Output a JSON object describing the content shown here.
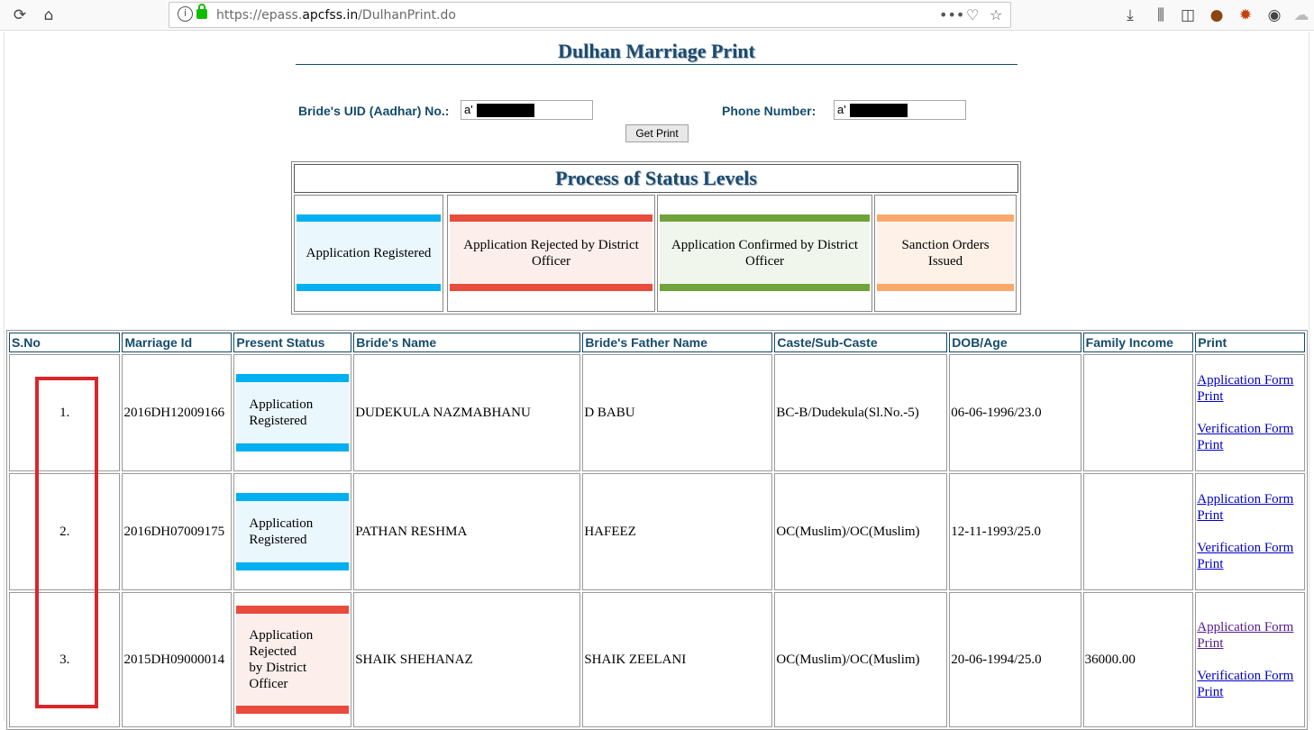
{
  "browser": {
    "url_prefix": "https://epass.",
    "url_domain": "apcfss.in",
    "url_path": "/DulhanPrint.do",
    "icons": [
      "reload-icon",
      "home-icon",
      "info-icon",
      "lock-icon",
      "more-icon",
      "pocket-icon",
      "bookmark-star-icon",
      "download-icon",
      "library-icon",
      "sidebar-icon",
      "cookie-extension-icon",
      "extension-icon",
      "account-icon",
      "ghost-extension-icon"
    ]
  },
  "page": {
    "title": "Dulhan Marriage Print",
    "uid_label": "Bride's UID (Aadhar) No.:",
    "uid_value": "a'",
    "phone_label": "Phone Number:",
    "phone_value": "a'",
    "get_print_label": "Get Print"
  },
  "levels": {
    "heading": "Process of Status Levels",
    "items": [
      {
        "label": "Application Registered",
        "band": "#00b0f0",
        "bg": "#eaf7fd"
      },
      {
        "label": "Application Rejected by District Officer",
        "band": "#e74c3c",
        "bg": "#fbeeeb"
      },
      {
        "label": "Application Confirmed by District Officer",
        "band": "#70a33a",
        "bg": "#f0f6ec"
      },
      {
        "label": "Sanction Orders Issued",
        "band": "#f9a86b",
        "bg": "#fef1e8"
      }
    ]
  },
  "table": {
    "headers": [
      "S.No",
      "Marriage Id",
      "Present Status",
      "Bride's Name",
      "Bride's Father Name",
      "Caste/Sub-Caste",
      "DOB/Age",
      "Family Income",
      "Print"
    ],
    "rows": [
      {
        "sno": "1.",
        "id": "2016DH12009166",
        "status": "Application Registered",
        "status_band": "#00b0f0",
        "status_bg": "#eaf7fd",
        "bride": "DUDEKULA NAZMABHANU",
        "father": "D BABU",
        "caste": "BC-B/Dudekula(Sl.No.-5)",
        "dob": "06-06-1996/23.0",
        "income": "",
        "app_link": "Application Form Print",
        "ver_link": "Verification Form Print"
      },
      {
        "sno": "2.",
        "id": "2016DH07009175",
        "status": "Application Registered",
        "status_band": "#00b0f0",
        "status_bg": "#eaf7fd",
        "bride": "PATHAN RESHMA",
        "father": "HAFEEZ",
        "caste": "OC(Muslim)/OC(Muslim)",
        "dob": "12-11-1993/25.0",
        "income": "",
        "app_link": "Application Form Print",
        "ver_link": "Verification Form Print"
      },
      {
        "sno": "3.",
        "id": "2015DH09000014",
        "status": "Application Rejected by District Officer",
        "status_band": "#e74c3c",
        "status_bg": "#fbeeeb",
        "bride": "SHAIK SHEHANAZ",
        "father": "SHAIK ZEELANI",
        "caste": "OC(Muslim)/OC(Muslim)",
        "dob": "20-06-1994/25.0",
        "income": "36000.00",
        "app_link": "Application Form Print",
        "ver_link": "Verification Form Print"
      }
    ]
  },
  "colors": {
    "heading": "#134b6b",
    "highlight_box": "#d9262b"
  }
}
